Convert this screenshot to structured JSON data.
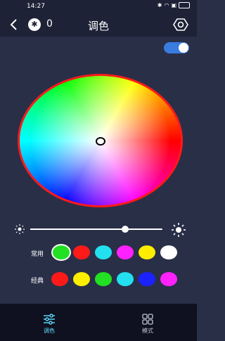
{
  "status": {
    "time": "14:27"
  },
  "header": {
    "device_count": "0",
    "title": "调色"
  },
  "toggle": {
    "on": true,
    "color": "#3a7be0"
  },
  "brightness": {
    "value": 0.72
  },
  "common": {
    "label": "常用",
    "colors": [
      "#22e022",
      "#ff1a1a",
      "#22e0f0",
      "#ff22ff",
      "#ffee00",
      "#ffffff"
    ],
    "selected_index": 0
  },
  "classic": {
    "label": "经典",
    "colors": [
      "#ff1a1a",
      "#ffee00",
      "#22e022",
      "#22e0f0",
      "#1a22ff",
      "#ff22ff"
    ]
  },
  "nav": {
    "tune_label": "调色",
    "mode_label": "模式",
    "active_color": "#5fe0ff",
    "inactive_color": "#bfc2d0"
  }
}
